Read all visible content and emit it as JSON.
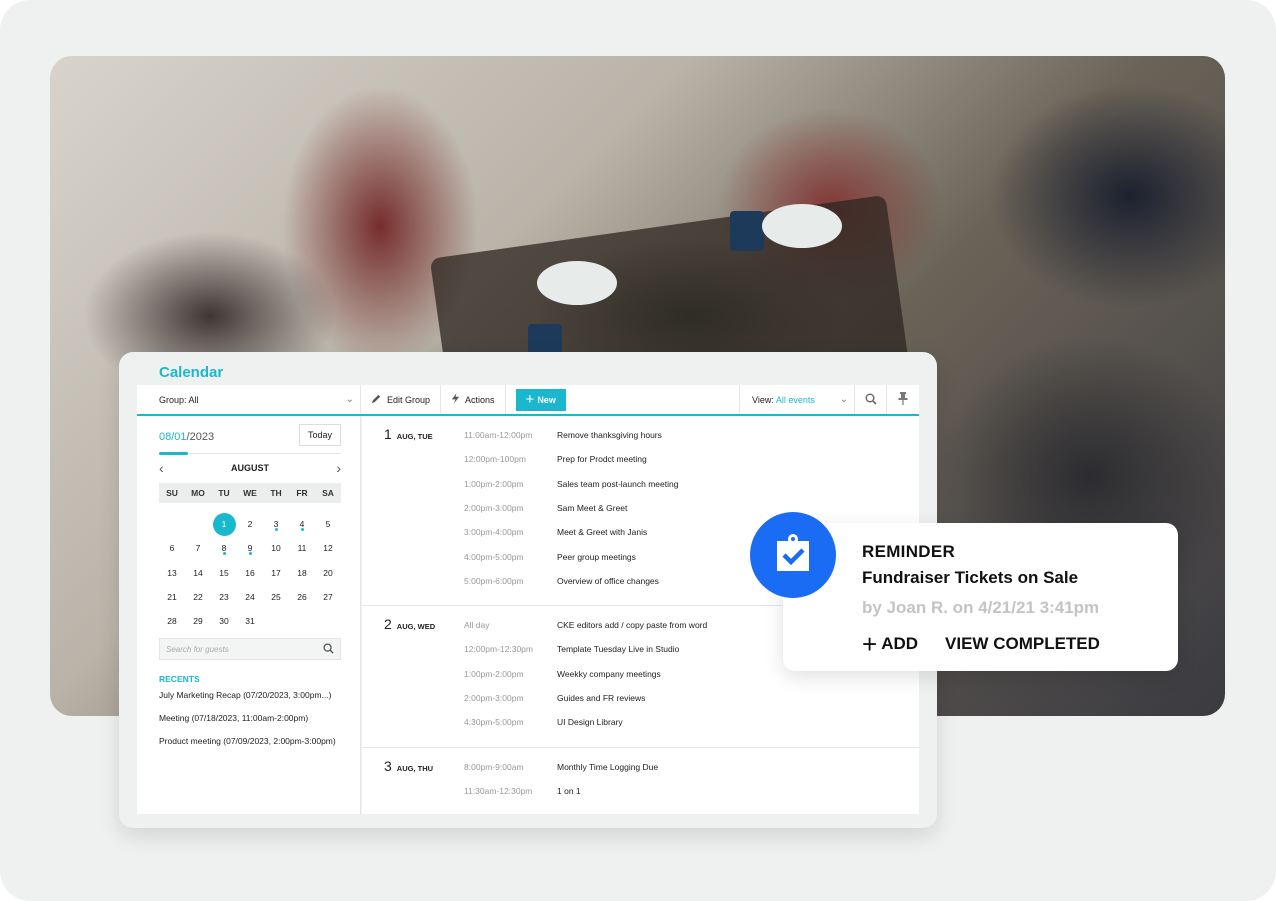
{
  "calendar": {
    "title": "Calendar",
    "toolbar": {
      "group_label": "Group: All",
      "edit_group": "Edit Group",
      "actions": "Actions",
      "new": "New",
      "view_prefix": "View:",
      "view_value": "All events",
      "accent_color": "#1ab8cf"
    },
    "date_picker": {
      "date_highlight": "08/01",
      "date_rest": "/2023",
      "today_button": "Today",
      "month": "AUGUST",
      "weekdays": [
        "SU",
        "MO",
        "TU",
        "WE",
        "TH",
        "FR",
        "SA"
      ],
      "weeks": [
        [
          null,
          null,
          {
            "d": "1",
            "sel": true
          },
          {
            "d": "2"
          },
          {
            "d": "3",
            "dot": true
          },
          {
            "d": "4",
            "dot": true
          },
          {
            "d": "5"
          }
        ],
        [
          {
            "d": "6"
          },
          {
            "d": "7"
          },
          {
            "d": "8",
            "dot": true
          },
          {
            "d": "9",
            "dot": true
          },
          {
            "d": "10"
          },
          {
            "d": "11"
          },
          {
            "d": "12"
          }
        ],
        [
          {
            "d": "13"
          },
          {
            "d": "14"
          },
          {
            "d": "15"
          },
          {
            "d": "16"
          },
          {
            "d": "17"
          },
          {
            "d": "18"
          },
          {
            "d": "20"
          }
        ],
        [
          {
            "d": "21"
          },
          {
            "d": "22"
          },
          {
            "d": "23"
          },
          {
            "d": "24"
          },
          {
            "d": "25"
          },
          {
            "d": "26"
          },
          {
            "d": "27"
          }
        ],
        [
          {
            "d": "28"
          },
          {
            "d": "29"
          },
          {
            "d": "30"
          },
          {
            "d": "31"
          },
          null,
          null,
          null
        ]
      ]
    },
    "search_guests_placeholder": "Search for guests",
    "recents_title": "RECENTS",
    "recents": [
      "July Marketing Recap (07/20/2023, 3:00pm...)",
      "Meeting (07/18/2023, 11:00am-2:00pm)",
      "Product meeting (07/09/2023, 2:00pm-3:00pm)"
    ],
    "agenda": [
      {
        "day": "1",
        "label": "AUG, TUE",
        "events": [
          {
            "time": "11:00am-12:00pm",
            "title": "Remove thanksgiving hours"
          },
          {
            "time": "12:00pm-100pm",
            "title": "Prep for Prodct meeting"
          },
          {
            "time": "1:00pm-2:00pm",
            "title": "Sales team post-launch meeting"
          },
          {
            "time": "2:00pm-3:00pm",
            "title": "Sam Meet & Greet"
          },
          {
            "time": "3:00pm-4:00pm",
            "title": "Meet & Greet with Janis"
          },
          {
            "time": "4:00pm-5:00pm",
            "title": "Peer group meetings"
          },
          {
            "time": "5:00pm-6:00pm",
            "title": "Overview of office changes"
          }
        ]
      },
      {
        "day": "2",
        "label": "AUG, WED",
        "events": [
          {
            "time": "All day",
            "title": "CKE editors add / copy paste from word"
          },
          {
            "time": "12:00pm-12:30pm",
            "title": "Template Tuesday Live in Studio"
          },
          {
            "time": "1:00pm-2:00pm",
            "title": "Weekky company meetings"
          },
          {
            "time": "2:00pm-3:00pm",
            "title": "Guides and FR reviews"
          },
          {
            "time": "4:30pm-5:00pm",
            "title": "UI Design Library"
          }
        ]
      },
      {
        "day": "3",
        "label": "AUG, THU",
        "events": [
          {
            "time": "8:00pm-9:00am",
            "title": "Monthly Time Logging Due"
          },
          {
            "time": "11:30am-12:30pm",
            "title": "1 on 1"
          }
        ]
      }
    ]
  },
  "reminder": {
    "icon": "clipboard-check-icon",
    "label": "REMINDER",
    "title": "Fundraiser Tickets on Sale",
    "byline": "by Joan R. on 4/21/21 3:41pm",
    "add_label": "ADD",
    "view_completed_label": "VIEW COMPLETED",
    "icon_color": "#1a6cf5"
  }
}
